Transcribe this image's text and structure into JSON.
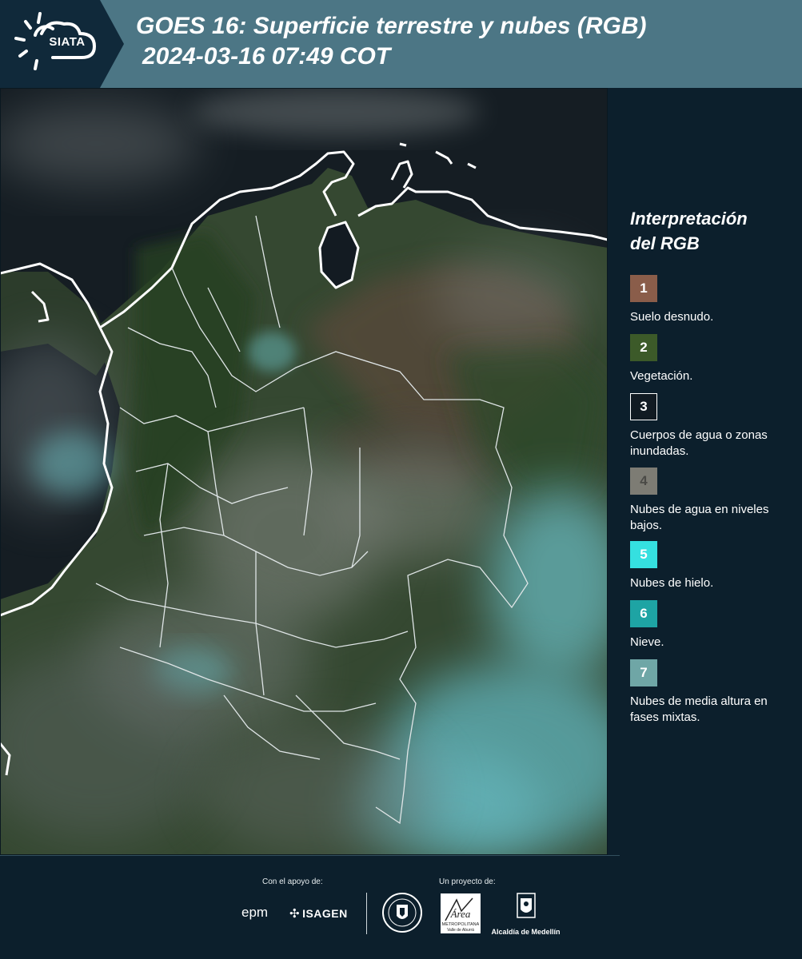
{
  "header": {
    "logo_text": "SIATA",
    "title_line1": "GOES 16: Superficie terrestre y nubes (RGB)",
    "title_line2": "2024-03-16 07:49 COT"
  },
  "legend": {
    "title_line1": "Interpretación",
    "title_line2": "del RGB",
    "items": [
      {
        "number": "1",
        "label": "Suelo desnudo.",
        "color": "#8a5d4a"
      },
      {
        "number": "2",
        "label": "Vegetación.",
        "color": "#3c5a29"
      },
      {
        "number": "3",
        "label": "Cuerpos de agua o zonas inundadas.",
        "color": "#111a22"
      },
      {
        "number": "4",
        "label": "Nubes de agua en niveles bajos.",
        "color": "#7d7c74"
      },
      {
        "number": "5",
        "label": "Nubes de hielo.",
        "color": "#35e0e0"
      },
      {
        "number": "6",
        "label": "Nieve.",
        "color": "#1ea4a4"
      },
      {
        "number": "7",
        "label": "Nubes de media altura en fases mixtas.",
        "color": "#6fa6a6"
      }
    ]
  },
  "footer": {
    "support_label": "Con el apoyo de:",
    "project_label": "Un proyecto de:",
    "epm": "epm",
    "isagen": "ISAGEN",
    "area_text_1": "Área",
    "area_text_2": "METROPOLITANA",
    "area_text_3": "Valle de Aburrá",
    "alcaldia": "Alcaldía de Medellín",
    "seal_text": "MEDELLÍN"
  },
  "colors": {
    "header_bg": "#4c7685",
    "page_bg": "#0c1f2c",
    "ocean": "#141c22",
    "land_green": "#2f4a2a",
    "cloud_cyan": "#5fb6bd"
  },
  "icons": [
    "sun-cloud-logo-icon",
    "medellin-seal-icon",
    "area-metropolitana-logo-icon",
    "alcaldia-crest-icon"
  ]
}
